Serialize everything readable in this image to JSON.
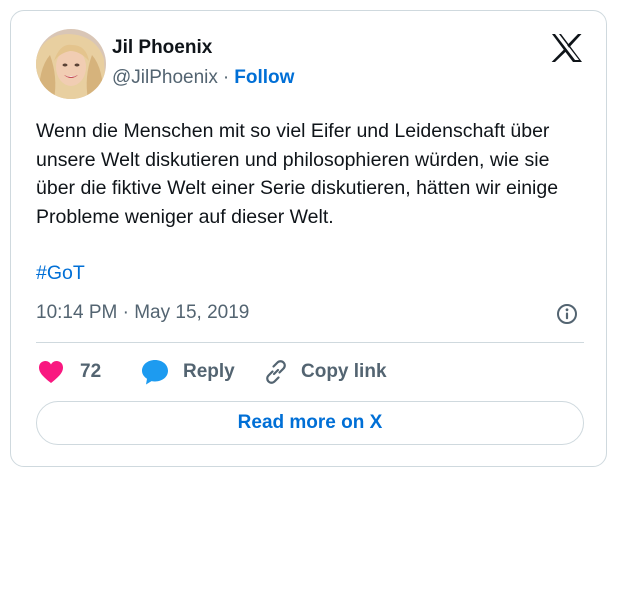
{
  "author": {
    "name": "Jil Phoenix",
    "handle": "@JilPhoenix",
    "separator": "·",
    "follow_label": "Follow",
    "avatar_icon": "profile-photo"
  },
  "platform_icon": "x-logo-icon",
  "tweet": {
    "text": "Wenn die Menschen mit so viel Eifer und Leidenschaft über unsere Welt diskutieren und philosophieren würden, wie sie über die fiktive Welt einer Serie diskutieren, hätten wir einige Probleme weniger auf dieser Welt.",
    "hashtag": "#GoT",
    "timestamp": "10:14 PM · May 15, 2019"
  },
  "actions": {
    "likes_count": "72",
    "reply_label": "Reply",
    "copy_link_label": "Copy link"
  },
  "read_more_label": "Read more on X",
  "colors": {
    "accent": "#006fd6",
    "like": "#f91880",
    "reply": "#1d9bf0",
    "text": "#0f1419",
    "muted": "#536471",
    "border": "#cfd9de"
  }
}
